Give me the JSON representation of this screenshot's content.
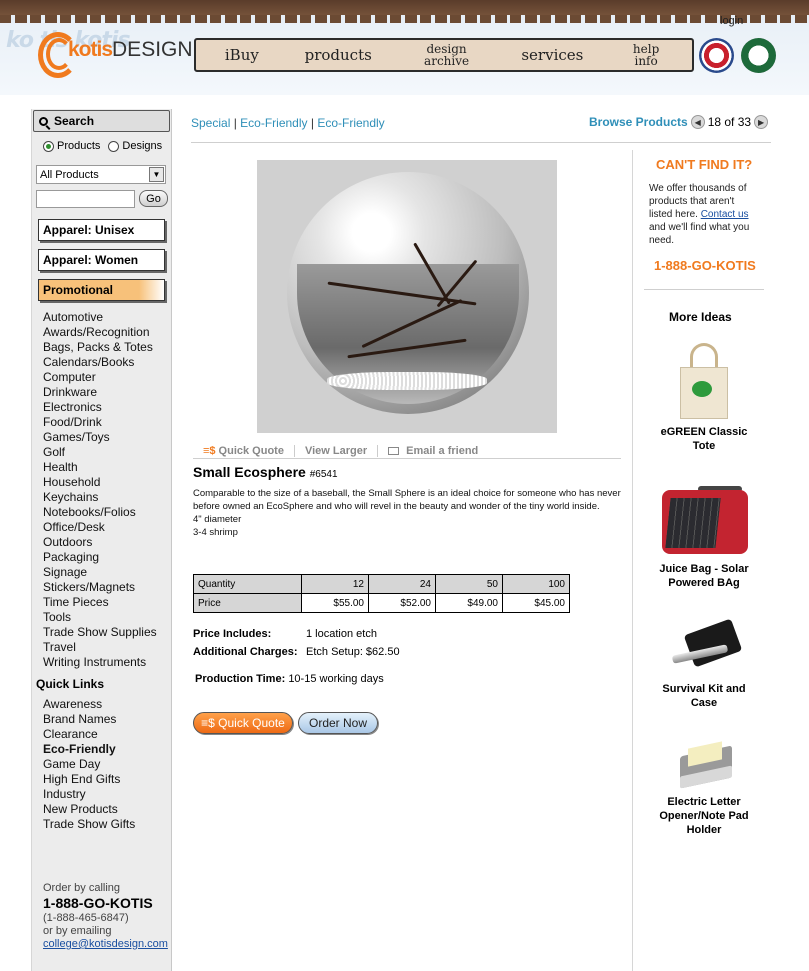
{
  "header": {
    "logo_main": "kotis",
    "logo_sub": "DESIGN",
    "bg_text": "ko tis kotis",
    "login": "login",
    "nav": [
      {
        "label": "iBuy"
      },
      {
        "label": "products"
      },
      {
        "label": "design archive"
      },
      {
        "label": "services"
      },
      {
        "label": "help info"
      }
    ]
  },
  "sidebar": {
    "search_title": "Search",
    "radio_products": "Products",
    "radio_designs": "Designs",
    "select_value": "All Products",
    "go_label": "Go",
    "apparel_unisex": "Apparel: Unisex",
    "apparel_women": "Apparel: Women",
    "promotional": "Promotional",
    "categories": [
      "Automotive",
      "Awards/Recognition",
      "Bags, Packs & Totes",
      "Calendars/Books",
      "Computer",
      "Drinkware",
      "Electronics",
      "Food/Drink",
      "Games/Toys",
      "Golf",
      "Health",
      "Household",
      "Keychains",
      "Notebooks/Folios",
      "Office/Desk",
      "Outdoors",
      "Packaging",
      "Signage",
      "Stickers/Magnets",
      "Time Pieces",
      "Tools",
      "Trade Show Supplies",
      "Travel",
      "Writing Instruments"
    ],
    "quick_links_title": "Quick Links",
    "quick_links": [
      "Awareness",
      "Brand Names",
      "Clearance",
      "Eco-Friendly",
      "Game Day",
      "High End Gifts",
      "Industry",
      "New Products",
      "Trade Show Gifts"
    ],
    "order_by": "Order by calling",
    "order_phone": "1-888-GO-KOTIS",
    "order_phone_num": "(1-888-465-6847)",
    "order_email_label": "or by emailing",
    "order_email": "college@kotisdesign.com"
  },
  "breadcrumb": {
    "items": [
      "Special",
      "Eco-Friendly",
      "Eco-Friendly"
    ],
    "sep": " | "
  },
  "browse": {
    "label": "Browse Products",
    "counter": "18 of 33"
  },
  "product": {
    "actions": {
      "quick_quote": "Quick Quote",
      "view_larger": "View Larger",
      "email_friend": "Email a friend"
    },
    "name": "Small Ecosphere",
    "sku": "#6541",
    "description": [
      "Comparable to the size of a baseball, the Small Sphere is an ideal choice for someone who has never before owned an EcoSphere and who will revel in the beauty and wonder of the tiny world inside.",
      "4\" diameter",
      "3-4 shrimp"
    ],
    "table": {
      "qty_label": "Quantity",
      "price_label": "Price",
      "quantities": [
        "12",
        "24",
        "50",
        "100"
      ],
      "prices": [
        "$55.00",
        "$52.00",
        "$49.00",
        "$45.00"
      ]
    },
    "price_includes_label": "Price Includes:",
    "price_includes": "1 location etch",
    "additional_label": "Additional Charges:",
    "additional": "Etch Setup: $62.50",
    "production_label": "Production Time:",
    "production": "10-15 working days",
    "btn_quick_quote": "Quick Quote",
    "btn_order_now": "Order Now"
  },
  "right": {
    "cant_find_title": "CAN'T FIND IT?",
    "cant_find_text": "We offer thousands of products that aren't listed here.",
    "contact_link": "Contact us",
    "cant_find_text2": "and we'll find what you need.",
    "phone": "1-888-GO-KOTIS",
    "more_ideas": "More Ideas",
    "ideas": [
      {
        "name": "eGREEN Classic Tote"
      },
      {
        "name": "Juice Bag - Solar Powered BAg"
      },
      {
        "name": "Survival Kit and Case"
      },
      {
        "name": "Electric Letter Opener/Note Pad Holder"
      }
    ]
  },
  "colors": {
    "accent_orange": "#f07a1e",
    "link_blue": "#2f8fb8"
  }
}
